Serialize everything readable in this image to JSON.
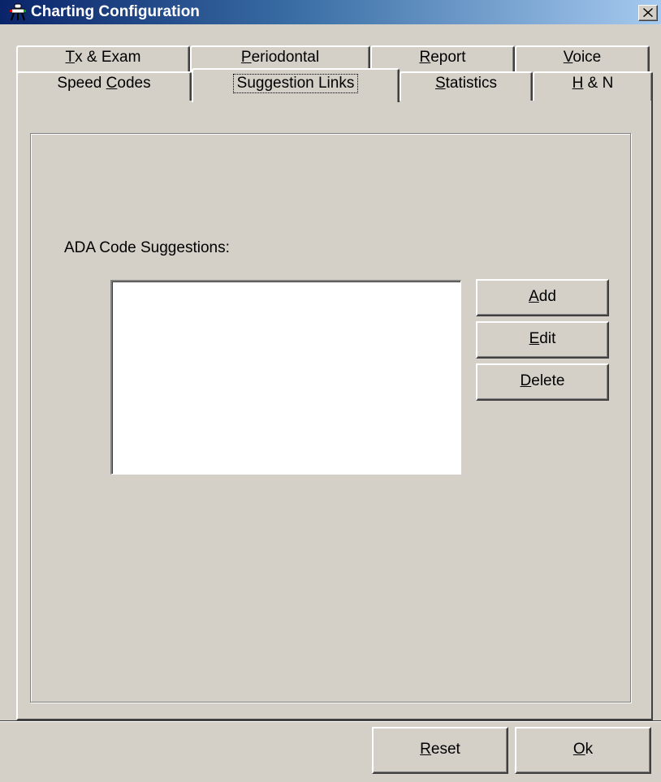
{
  "window": {
    "title": "Charting Configuration",
    "icon": "dental-chair-icon",
    "close_glyph": "×"
  },
  "tabs": {
    "row_back": [
      {
        "mnemonic": "T",
        "rest": "x & Exam",
        "pre": ""
      },
      {
        "pre": "",
        "mnemonic": "P",
        "rest": "eriodontal"
      },
      {
        "pre": "",
        "mnemonic": "R",
        "rest": "eport"
      },
      {
        "pre": "",
        "mnemonic": "V",
        "rest": "oice"
      }
    ],
    "row_front": [
      {
        "pre": "Speed ",
        "mnemonic": "C",
        "rest": "odes"
      },
      {
        "pre": "Suggestion Links",
        "mnemonic": "",
        "rest": ""
      },
      {
        "pre": "",
        "mnemonic": "S",
        "rest": "tatistics"
      },
      {
        "pre": "",
        "mnemonic": "H",
        "rest": " & N"
      }
    ],
    "active": "Suggestion Links"
  },
  "suggestions": {
    "label": "ADA Code Suggestions:",
    "items": [],
    "buttons": [
      {
        "pre": "",
        "mnemonic": "A",
        "rest": "dd"
      },
      {
        "pre": "",
        "mnemonic": "E",
        "rest": "dit"
      },
      {
        "pre": "",
        "mnemonic": "D",
        "rest": "elete"
      }
    ]
  },
  "footer": {
    "reset": {
      "pre": "",
      "mnemonic": "R",
      "rest": "eset"
    },
    "ok": {
      "pre": "",
      "mnemonic": "O",
      "rest": "k"
    }
  }
}
